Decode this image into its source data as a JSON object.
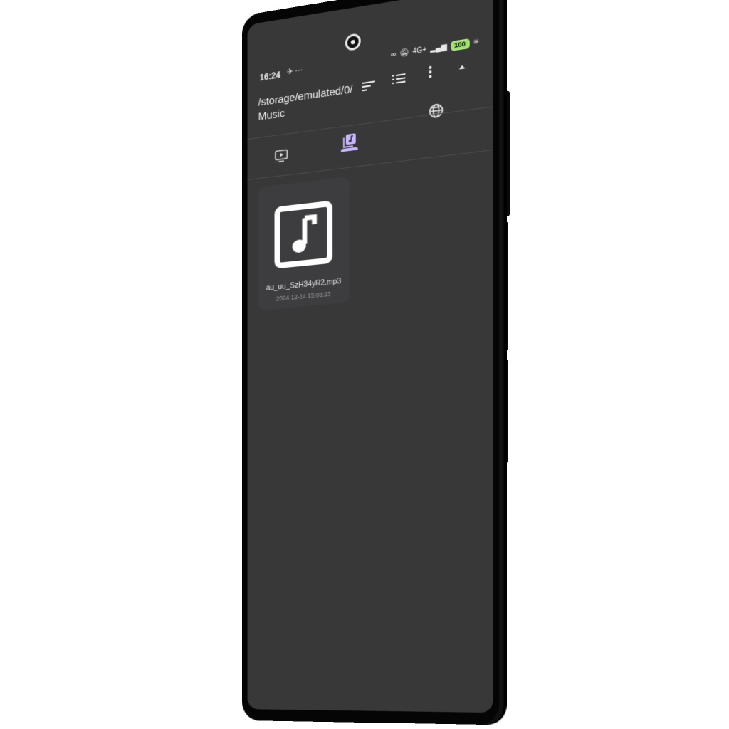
{
  "status_bar": {
    "time": "16:24",
    "extra": "✈ ⋯",
    "battery": "100",
    "network": "4G+"
  },
  "toolbar": {
    "path_line1": "/storage/emulated/0/",
    "path_line2": "Music"
  },
  "icons": {
    "sort": "sort-icon",
    "list_view": "list-view-icon",
    "more": "more-vert-icon",
    "collapse": "chevron-up-icon",
    "web": "globe-icon"
  },
  "tabs": [
    {
      "icon": "video-icon",
      "active": false
    },
    {
      "icon": "music-library-icon",
      "active": true
    }
  ],
  "files": [
    {
      "name": "au_uu_SzH34yR2.mp3",
      "date": "2024-12-14 15:03:23",
      "icon": "music-file-icon"
    }
  ],
  "colors": {
    "screen_bg": "#383839",
    "accent": "#c8b6ff",
    "battery_green": "#9be36b"
  }
}
